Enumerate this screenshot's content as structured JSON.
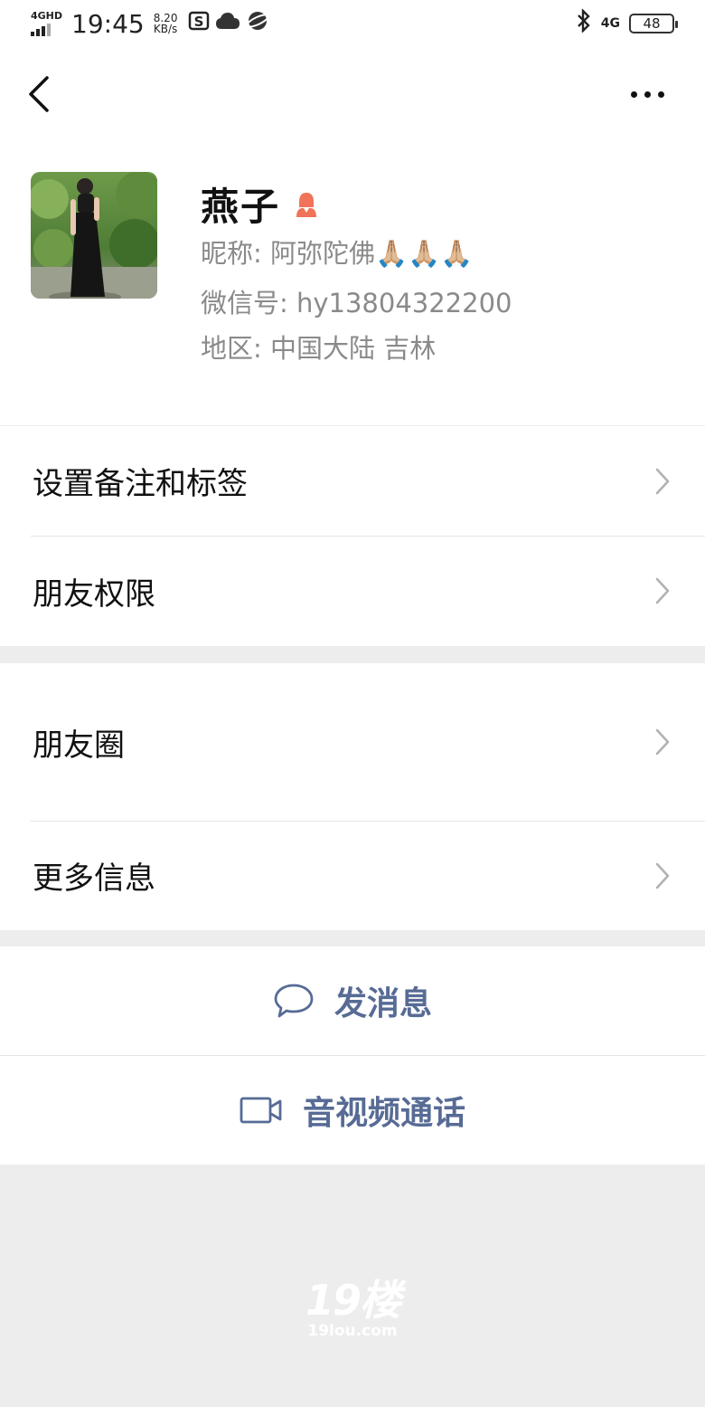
{
  "status_bar": {
    "network_type": "4GHD",
    "time": "19:45",
    "speed_value": "8.20",
    "speed_unit": "KB/s",
    "right_network": "4G",
    "battery": "48"
  },
  "profile": {
    "name": "燕子",
    "nickname_line": "昵称: 阿弥陀佛🙏🏼🙏🏼🙏🏼",
    "wechat_id_line": "微信号: hy13804322200",
    "region_line": "地区: 中国大陆  吉林"
  },
  "menu_group_1": {
    "items": [
      {
        "label": "设置备注和标签"
      },
      {
        "label": "朋友权限"
      }
    ]
  },
  "menu_group_2": {
    "items": [
      {
        "label": "朋友圈"
      },
      {
        "label": "更多信息"
      }
    ]
  },
  "actions": {
    "send_message": "发消息",
    "video_call": "音视频通话"
  },
  "watermark": {
    "big": "19楼",
    "small": "19lou.com"
  },
  "colors": {
    "link_blue": "#576b95",
    "gender_female": "#f0735a",
    "background": "#ededed"
  }
}
